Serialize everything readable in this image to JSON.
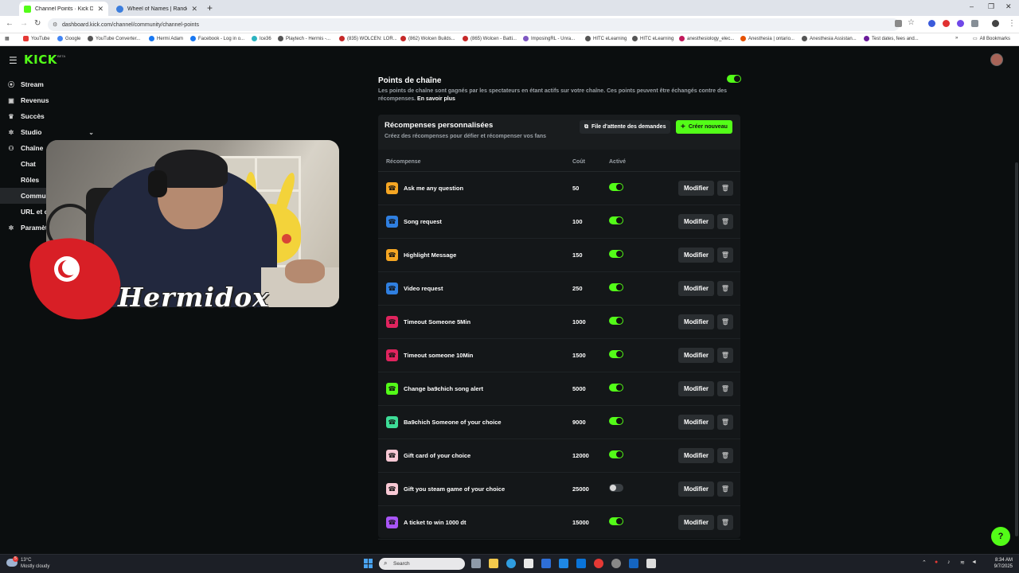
{
  "browser": {
    "tabs": [
      {
        "title": "Channel Points · Kick Dashboa",
        "active": true,
        "color": "#53fc18"
      },
      {
        "title": "Wheel of Names | Random nam",
        "active": false,
        "color": "#3b7ddd"
      }
    ],
    "url": "dashboard.kick.com/channel/community/channel-points",
    "bookmarks": [
      {
        "label": "YouTube",
        "color": "#e53935"
      },
      {
        "label": "Google",
        "color": "#4285f4"
      },
      {
        "label": "YouTube Converter...",
        "color": "#555555"
      },
      {
        "label": "Hermi Adam",
        "color": "#1877f2"
      },
      {
        "label": "Facebook - Log in o...",
        "color": "#1877f2"
      },
      {
        "label": "Ice36",
        "color": "#2bb3c0"
      },
      {
        "label": "Playtech - Hermis -...",
        "color": "#555555"
      },
      {
        "label": "(835) WOLCEN: LOR...",
        "color": "#c62828"
      },
      {
        "label": "(862) Wolcen Builds...",
        "color": "#c62828"
      },
      {
        "label": "(865) Wolcen - Batti...",
        "color": "#c62828"
      },
      {
        "label": "ImposingRL - Unra...",
        "color": "#7e57c2"
      },
      {
        "label": "HITC eLearning",
        "color": "#555555"
      },
      {
        "label": "HITC eLearning",
        "color": "#555555"
      },
      {
        "label": "anesthesiology_elec...",
        "color": "#c2185b"
      },
      {
        "label": "Anesthesia | ontario...",
        "color": "#e65100"
      },
      {
        "label": "Anesthesia Assistan...",
        "color": "#555555"
      },
      {
        "label": "Test dates, fees and...",
        "color": "#6a1b9a"
      }
    ],
    "all_bookmarks": "All Bookmarks"
  },
  "app": {
    "logo": "KICK",
    "logo_badge": "BETA",
    "accent": "#53fc18"
  },
  "sidebar": {
    "items": [
      {
        "label": "Stream",
        "icon": "broadcast-icon"
      },
      {
        "label": "Revenus",
        "icon": "wallet-icon"
      },
      {
        "label": "Succès",
        "icon": "trophy-icon"
      },
      {
        "label": "Studio",
        "icon": "gear-icon"
      },
      {
        "label": "Chaîne",
        "icon": "people-icon"
      },
      {
        "label": "Chat",
        "icon": ""
      },
      {
        "label": "Rôles",
        "icon": ""
      },
      {
        "label": "Commun",
        "icon": ""
      },
      {
        "label": "URL et c",
        "icon": ""
      },
      {
        "label": "Paramèt",
        "icon": "gear-icon"
      }
    ]
  },
  "webcam": {
    "name": "Hermidox"
  },
  "channel_points": {
    "title": "Points de chaîne",
    "enabled": true,
    "description": "Les points de chaîne sont gagnés par les spectateurs en étant actifs sur votre chaîne. Ces points peuvent être échangés contre des récompenses.",
    "learn_more": "En savoir plus"
  },
  "rewards": {
    "title": "Récompenses personnalisées",
    "subtitle": "Créez des récompenses pour défier et récompenser vos fans",
    "queue_button": "File d'attente des demandes",
    "create_button": "Créer nouveau",
    "columns": {
      "reward": "Récompense",
      "cost": "Coût",
      "active": "Activé"
    },
    "edit_label": "Modifier",
    "items": [
      {
        "name": "Ask me any question",
        "cost": "50",
        "active": true,
        "color": "#f5a623"
      },
      {
        "name": "Song request",
        "cost": "100",
        "active": true,
        "color": "#2f7fe0"
      },
      {
        "name": "Highlight Message",
        "cost": "150",
        "active": true,
        "color": "#f5a623"
      },
      {
        "name": "Video request",
        "cost": "250",
        "active": true,
        "color": "#2f7fe0"
      },
      {
        "name": "Timeout Someone 5Min",
        "cost": "1000",
        "active": true,
        "color": "#e0245e"
      },
      {
        "name": "Timeout someone 10Min",
        "cost": "1500",
        "active": true,
        "color": "#e0245e"
      },
      {
        "name": "Change ba9chich song alert",
        "cost": "5000",
        "active": true,
        "color": "#53fc18"
      },
      {
        "name": "Ba9chich Someone of your choice",
        "cost": "9000",
        "active": true,
        "color": "#3ddc97"
      },
      {
        "name": "Gift card of your choice",
        "cost": "12000",
        "active": true,
        "color": "#f8c8d4"
      },
      {
        "name": "Gift you steam game of your choice",
        "cost": "25000",
        "active": false,
        "color": "#f8c8d4"
      },
      {
        "name": "A ticket to win 1000 dt",
        "cost": "15000",
        "active": true,
        "color": "#a855f7"
      }
    ]
  },
  "taskbar": {
    "weather_temp": "13°C",
    "weather_desc": "Mostly cloudy",
    "weather_badge": "5",
    "search_placeholder": "Search",
    "time": "8:34 AM",
    "date": "9/7/2025"
  }
}
